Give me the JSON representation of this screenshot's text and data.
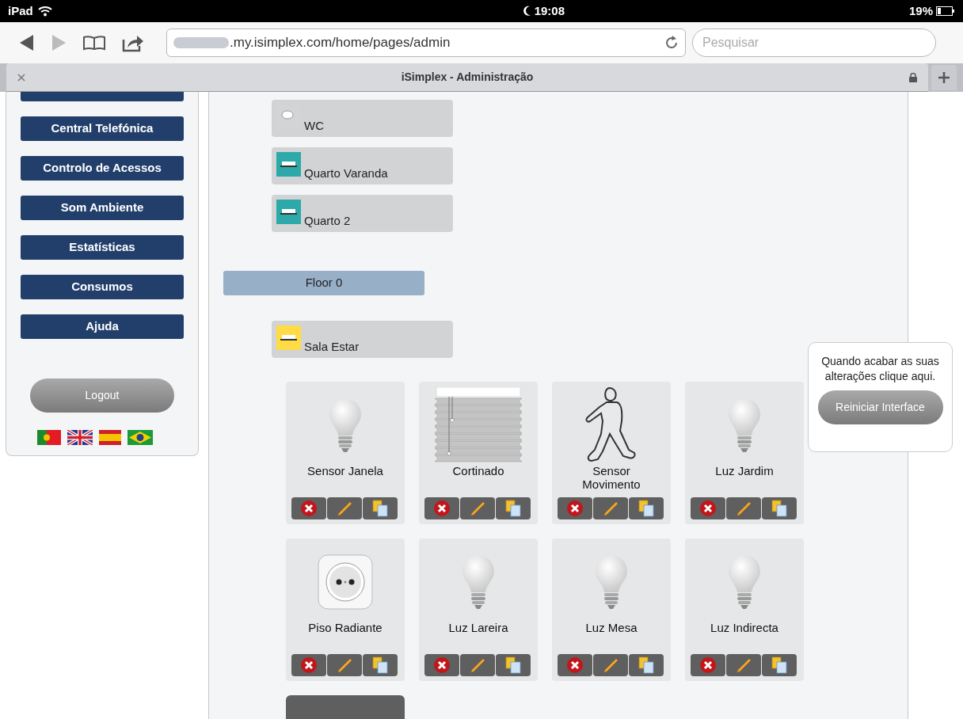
{
  "status_bar": {
    "device": "iPad",
    "time": "19:08",
    "battery": "19%"
  },
  "browser": {
    "url": ".my.isimplex.com/home/pages/admin",
    "search_placeholder": "Pesquisar",
    "tab_title": "iSimplex - Administração"
  },
  "sidebar": {
    "items": [
      "Central Telefónica",
      "Controlo de Acessos",
      "Som Ambiente",
      "Estatísticas",
      "Consumos",
      "Ajuda"
    ],
    "logout": "Logout"
  },
  "rooms": [
    {
      "name": "WC",
      "kind": "sink"
    },
    {
      "name": "Quarto Varanda",
      "kind": "bed"
    },
    {
      "name": "Quarto 2",
      "kind": "bed"
    }
  ],
  "floor": {
    "label": "Floor 0",
    "rooms": [
      {
        "name": "Sala Estar",
        "kind": "sofa"
      }
    ]
  },
  "devices": [
    {
      "name": "Sensor Janela",
      "kind": "bulb"
    },
    {
      "name": "Cortinado",
      "kind": "blind"
    },
    {
      "name": "Sensor Movimento",
      "kind": "walker"
    },
    {
      "name": "Luz Jardim",
      "kind": "bulb"
    },
    {
      "name": "Piso Radiante",
      "kind": "socket"
    },
    {
      "name": "Luz Lareira",
      "kind": "bulb"
    },
    {
      "name": "Luz Mesa",
      "kind": "bulb"
    },
    {
      "name": "Luz Indirecta",
      "kind": "bulb"
    }
  ],
  "notice": {
    "text": "Quando acabar as suas alterações clique aqui.",
    "button": "Reiniciar Interface"
  }
}
